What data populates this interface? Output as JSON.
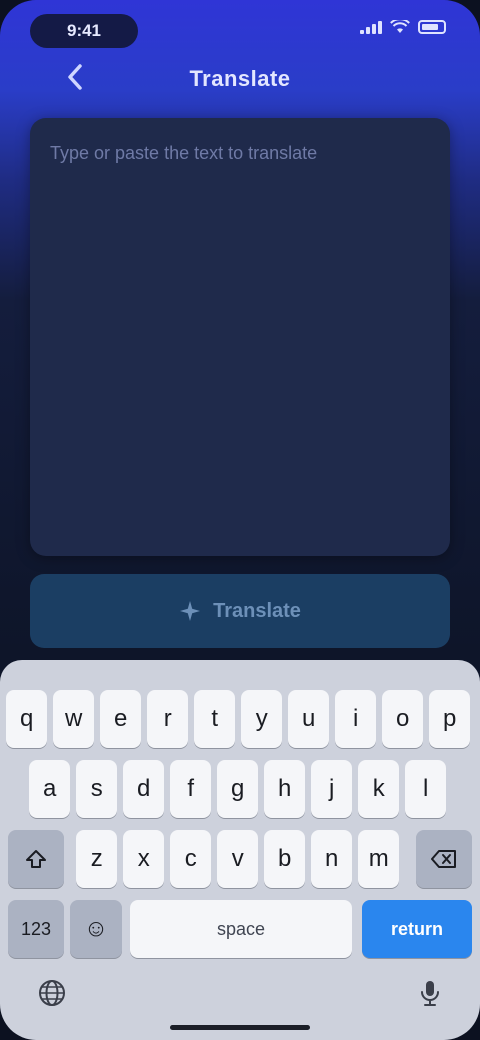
{
  "status_bar": {
    "time": "9:41",
    "icons": [
      "signal-icon",
      "wifi-icon",
      "battery-icon"
    ]
  },
  "nav": {
    "back_icon": "chevron-left-icon",
    "title": "Translate"
  },
  "input": {
    "placeholder": "Type or paste the text to translate",
    "value": ""
  },
  "action_button": {
    "label": "Translate",
    "icon": "sparkle-icon"
  },
  "keyboard": {
    "row1": [
      "q",
      "w",
      "e",
      "r",
      "t",
      "y",
      "u",
      "i",
      "o",
      "p"
    ],
    "row2": [
      "a",
      "s",
      "d",
      "f",
      "g",
      "h",
      "j",
      "k",
      "l"
    ],
    "row3": [
      "z",
      "x",
      "c",
      "v",
      "b",
      "n",
      "m"
    ],
    "shift_icon": "shift-icon",
    "delete_icon": "delete-icon",
    "numbers_label": "123",
    "emoji_label": "☺",
    "space_label": "space",
    "return_label": "return",
    "globe_icon": "globe-icon",
    "mic_icon": "mic-icon"
  },
  "colors": {
    "header_gradient_top": "#2f35d6",
    "background": "#0e1529",
    "card": "#1f2a4b",
    "action_button": "#1b3e63",
    "return_key": "#2a86ee",
    "keyboard": "#cdd1dc"
  }
}
